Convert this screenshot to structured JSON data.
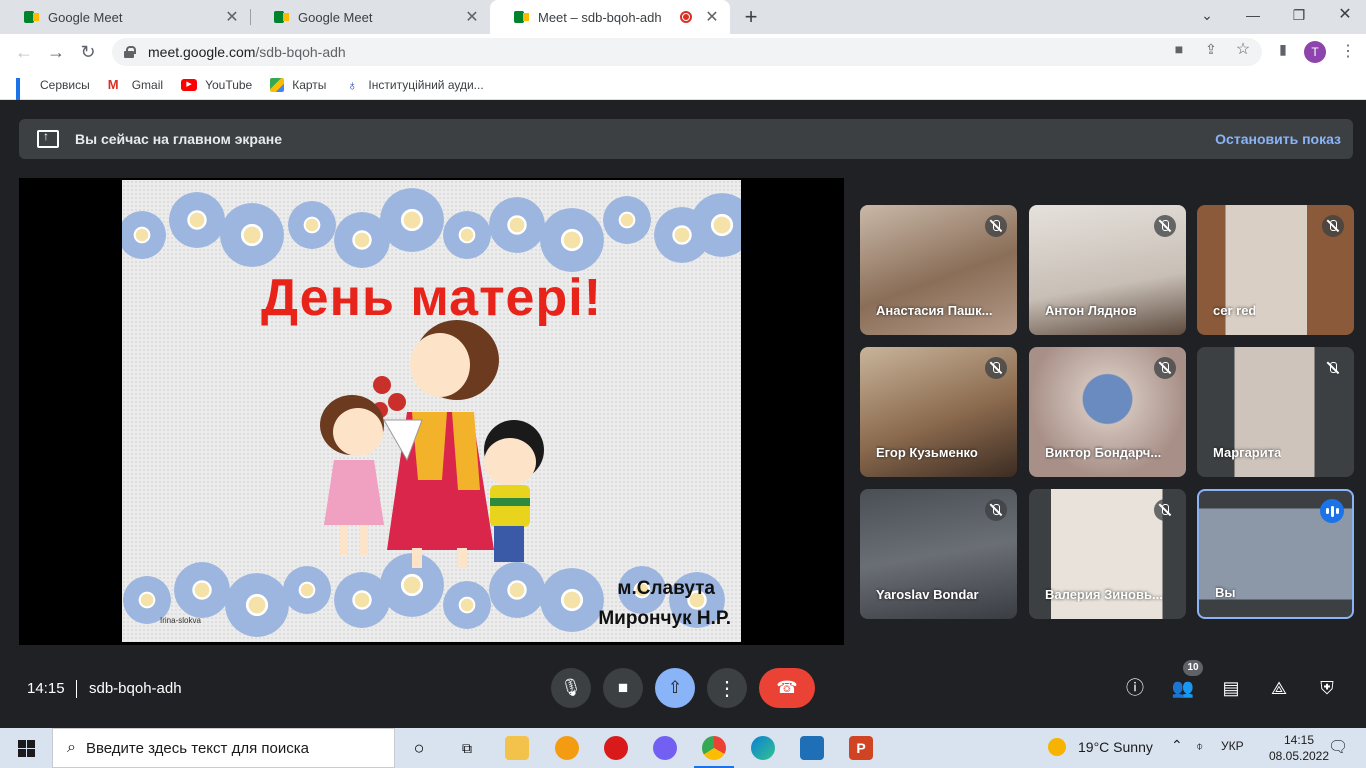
{
  "browser": {
    "tabs": [
      {
        "title": "Google Meet",
        "active": false
      },
      {
        "title": "Google Meet",
        "active": false
      },
      {
        "title": "Meet – sdb-bqoh-adh",
        "active": true,
        "recording": true
      }
    ],
    "url_host": "meet.google.com",
    "url_path": "/sdb-bqoh-adh",
    "profile_initial": "T",
    "bookmarks": [
      {
        "label": "Сервисы",
        "icon": "apps-grid-icon"
      },
      {
        "label": "Gmail",
        "icon": "gmail-icon"
      },
      {
        "label": "YouTube",
        "icon": "youtube-icon"
      },
      {
        "label": "Карты",
        "icon": "maps-icon"
      },
      {
        "label": "Інституційний ауди...",
        "icon": "institution-icon"
      }
    ]
  },
  "meet": {
    "banner": {
      "text": "Вы сейчас на главном экране",
      "stop_label": "Остановить показ"
    },
    "slide": {
      "title": "День матері!",
      "place": "м.Славута",
      "teacher": "Мирончук Н.Р.",
      "watermark": "Irina-slokva"
    },
    "participants": [
      {
        "name": "Анастасия Пашк...",
        "muted": true
      },
      {
        "name": "Антон Ляднов",
        "muted": true
      },
      {
        "name": "cer red",
        "muted": true
      },
      {
        "name": "Егор Кузьменко",
        "muted": true
      },
      {
        "name": "Виктор Бондарч...",
        "muted": true
      },
      {
        "name": "Маргарита",
        "muted": true
      },
      {
        "name": "Yaroslav Bondar",
        "muted": true
      },
      {
        "name": "Валерия Зиновь...",
        "muted": true
      },
      {
        "name": "Вы",
        "muted": false,
        "speaking": true
      }
    ],
    "bottom": {
      "time": "14:15",
      "meeting_code": "sdb-bqoh-adh",
      "people_count": "10"
    }
  },
  "taskbar": {
    "search_placeholder": "Введите здесь текст для поиска",
    "weather": "19°C  Sunny",
    "lang": "УКР",
    "time": "14:15",
    "date": "08.05.2022"
  },
  "colors": {
    "meet_bg": "#202124",
    "accent": "#8ab4f8",
    "end_call": "#ea4335",
    "slide_title": "#e8231a"
  }
}
